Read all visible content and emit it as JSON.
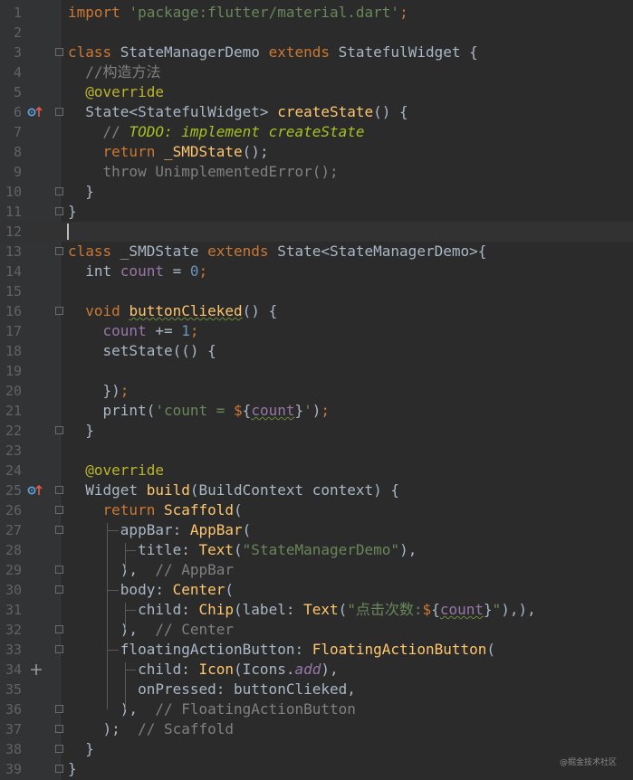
{
  "editor": {
    "lines": [
      {
        "n": "1",
        "spans": [
          [
            "kw",
            "import "
          ],
          [
            "str",
            "'package:flutter/material.dart'"
          ],
          [
            "kw",
            ";"
          ]
        ]
      },
      {
        "n": "2",
        "spans": []
      },
      {
        "n": "3",
        "fold": true,
        "spans": [
          [
            "kw",
            "class "
          ],
          [
            "",
            "StateManagerDemo "
          ],
          [
            "kw",
            "extends "
          ],
          [
            "",
            "StatefulWidget {"
          ]
        ]
      },
      {
        "n": "4",
        "spans": [
          [
            "cmt",
            "  //构造方法"
          ]
        ]
      },
      {
        "n": "5",
        "spans": [
          [
            "",
            "  "
          ],
          [
            "ann",
            "@override"
          ]
        ]
      },
      {
        "n": "6",
        "marker": "override-icon",
        "fold": true,
        "spans": [
          [
            "",
            "  State<StatefulWidget> "
          ],
          [
            "fn",
            "createState"
          ],
          [
            "",
            "() {"
          ]
        ]
      },
      {
        "n": "7",
        "spans": [
          [
            "cmt",
            "    // "
          ],
          [
            "todo",
            "TODO: implement createState"
          ]
        ]
      },
      {
        "n": "8",
        "spans": [
          [
            "",
            "    "
          ],
          [
            "kw",
            "return "
          ],
          [
            "fn",
            "_SMDState"
          ],
          [
            "",
            "();"
          ]
        ]
      },
      {
        "n": "9",
        "spans": [
          [
            "cmt",
            "    throw UnimplementedError();"
          ]
        ]
      },
      {
        "n": "10",
        "fold": true,
        "spans": [
          [
            "",
            "  }"
          ]
        ]
      },
      {
        "n": "11",
        "fold": true,
        "spans": [
          [
            "",
            "}"
          ]
        ]
      },
      {
        "n": "12",
        "current": true,
        "caret": true,
        "spans": []
      },
      {
        "n": "13",
        "fold": true,
        "spans": [
          [
            "kw",
            "class "
          ],
          [
            "",
            "_SMDState "
          ],
          [
            "kw",
            "extends "
          ],
          [
            "",
            "State<StateManagerDemo>{"
          ]
        ]
      },
      {
        "n": "14",
        "spans": [
          [
            "",
            "  int "
          ],
          [
            "field",
            "count"
          ],
          [
            "",
            " = "
          ],
          [
            "num",
            "0"
          ],
          [
            "kw",
            ";"
          ]
        ]
      },
      {
        "n": "15",
        "spans": []
      },
      {
        "n": "16",
        "fold": true,
        "spans": [
          [
            "",
            "  "
          ],
          [
            "kw",
            "void "
          ],
          [
            "fn warn",
            "buttonClieked"
          ],
          [
            "",
            "() {"
          ]
        ]
      },
      {
        "n": "17",
        "spans": [
          [
            "",
            "    "
          ],
          [
            "field",
            "count"
          ],
          [
            "",
            " += "
          ],
          [
            "num",
            "1"
          ],
          [
            "kw",
            ";"
          ]
        ]
      },
      {
        "n": "18",
        "spans": [
          [
            "",
            "    setState(() {"
          ]
        ]
      },
      {
        "n": "19",
        "spans": []
      },
      {
        "n": "20",
        "spans": [
          [
            "",
            "    })"
          ],
          [
            "kw",
            ";"
          ]
        ]
      },
      {
        "n": "21",
        "spans": [
          [
            "",
            "    print("
          ],
          [
            "str",
            "'count = "
          ],
          [
            "kw",
            "$"
          ],
          [
            "",
            "{"
          ],
          [
            "field warn",
            "count"
          ],
          [
            "",
            "}"
          ],
          [
            "str",
            "'"
          ],
          [
            "",
            ")"
          ],
          [
            "kw",
            ";"
          ]
        ]
      },
      {
        "n": "22",
        "fold": true,
        "spans": [
          [
            "",
            "  }"
          ]
        ]
      },
      {
        "n": "23",
        "spans": []
      },
      {
        "n": "24",
        "spans": [
          [
            "",
            "  "
          ],
          [
            "ann",
            "@override"
          ]
        ]
      },
      {
        "n": "25",
        "marker": "override-icon",
        "fold": true,
        "spans": [
          [
            "",
            "  Widget "
          ],
          [
            "fn",
            "build"
          ],
          [
            "",
            "(BuildContext context) {"
          ]
        ]
      },
      {
        "n": "26",
        "fold": true,
        "spans": [
          [
            "",
            "    "
          ],
          [
            "kw",
            "return "
          ],
          [
            "fn",
            "Scaffold"
          ],
          [
            "",
            "("
          ]
        ]
      },
      {
        "n": "27",
        "fold": true,
        "spans": [
          [
            "",
            "      appBar: "
          ],
          [
            "fn",
            "AppBar"
          ],
          [
            "",
            "("
          ]
        ]
      },
      {
        "n": "28",
        "spans": [
          [
            "",
            "        title: "
          ],
          [
            "fn",
            "Text"
          ],
          [
            "",
            "("
          ],
          [
            "str",
            "\"StateManagerDemo\""
          ],
          [
            "",
            "),"
          ]
        ]
      },
      {
        "n": "29",
        "fold": true,
        "spans": [
          [
            "",
            "      ),  "
          ],
          [
            "cmt",
            "// AppBar"
          ]
        ]
      },
      {
        "n": "30",
        "fold": true,
        "spans": [
          [
            "",
            "      body: "
          ],
          [
            "fn",
            "Center"
          ],
          [
            "",
            "("
          ]
        ]
      },
      {
        "n": "31",
        "spans": [
          [
            "",
            "        child: "
          ],
          [
            "fn",
            "Chip"
          ],
          [
            "",
            "(label: "
          ],
          [
            "fn",
            "Text"
          ],
          [
            "",
            "("
          ],
          [
            "str",
            "\"点击次数:"
          ],
          [
            "kw",
            "$"
          ],
          [
            "",
            "{"
          ],
          [
            "field warn",
            "count"
          ],
          [
            "",
            "}"
          ],
          [
            "str",
            "\""
          ],
          [
            "",
            "),),"
          ]
        ]
      },
      {
        "n": "32",
        "fold": true,
        "spans": [
          [
            "",
            "      ),  "
          ],
          [
            "cmt",
            "// Center"
          ]
        ]
      },
      {
        "n": "33",
        "fold": true,
        "spans": [
          [
            "",
            "      floatingActionButton: "
          ],
          [
            "fn",
            "FloatingActionButton"
          ],
          [
            "",
            "("
          ]
        ]
      },
      {
        "n": "34",
        "marker": "plus-icon",
        "spans": [
          [
            "",
            "        child: "
          ],
          [
            "fn",
            "Icon"
          ],
          [
            "",
            "(Icons."
          ],
          [
            "ital",
            "add"
          ],
          [
            "",
            "),"
          ]
        ]
      },
      {
        "n": "35",
        "spans": [
          [
            "",
            "        onPressed: buttonClieked,"
          ]
        ]
      },
      {
        "n": "36",
        "fold": true,
        "spans": [
          [
            "",
            "      ),  "
          ],
          [
            "cmt",
            "// FloatingActionButton"
          ]
        ]
      },
      {
        "n": "37",
        "fold": true,
        "spans": [
          [
            "",
            "    );  "
          ],
          [
            "cmt",
            "// Scaffold"
          ]
        ]
      },
      {
        "n": "38",
        "fold": true,
        "spans": [
          [
            "",
            "  }"
          ]
        ]
      },
      {
        "n": "39",
        "fold": true,
        "spans": [
          [
            "",
            "}"
          ]
        ]
      }
    ]
  },
  "icons": {
    "override": "override-up-arrow-icon",
    "plus": "plus-icon",
    "fold": "fold-marker-icon"
  },
  "colors": {
    "background": "#2b2b2b",
    "gutter": "#313335",
    "keyword": "#cc7832",
    "string": "#6a8759",
    "function": "#ffc66d",
    "number": "#6897bb",
    "field": "#9876aa",
    "comment": "#808080",
    "annotation": "#bbb529",
    "todo": "#a8c023"
  },
  "watermark": "@掘金技术社区"
}
